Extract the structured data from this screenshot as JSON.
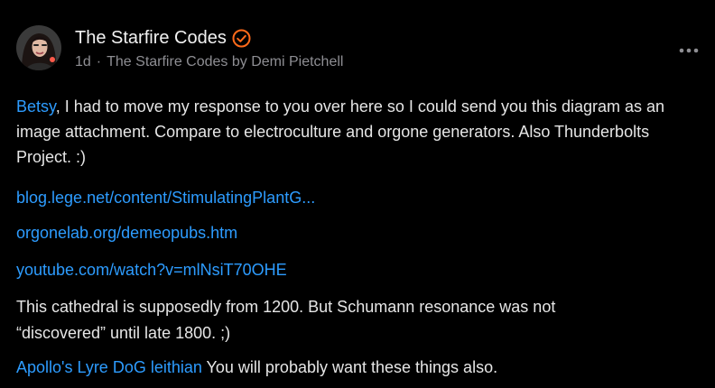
{
  "post": {
    "author": "The Starfire Codes",
    "time": "1d",
    "separator": "·",
    "publication": "The Starfire Codes by Demi Pietchell"
  },
  "body": {
    "mention": "Betsy",
    "intro": ", I had to move my response to you over here so I could send you this diagram as an image attachment. Compare to electroculture and orgone generators. Also Thunderbolts Project. :)",
    "links": [
      "blog.lege.net/content/StimulatingPlantG...",
      "orgonelab.org/demeopubs.htm",
      "youtube.com/watch?v=mlNsiT70OHE"
    ],
    "cathedral": "This cathedral is supposedly from 1200. But Schumann resonance was not “discovered” until late 1800. ;)",
    "mention2": "Apollo's Lyre DoG leithian",
    "closing": " You will probably want these things also."
  },
  "icons": {
    "verified": "verified-check-icon",
    "more": "more-dots-icon"
  },
  "colors": {
    "background": "#000000",
    "text": "#e6e6e6",
    "muted": "#8e8e93",
    "link": "#2d9cff",
    "verified": "#ff6a1a"
  }
}
